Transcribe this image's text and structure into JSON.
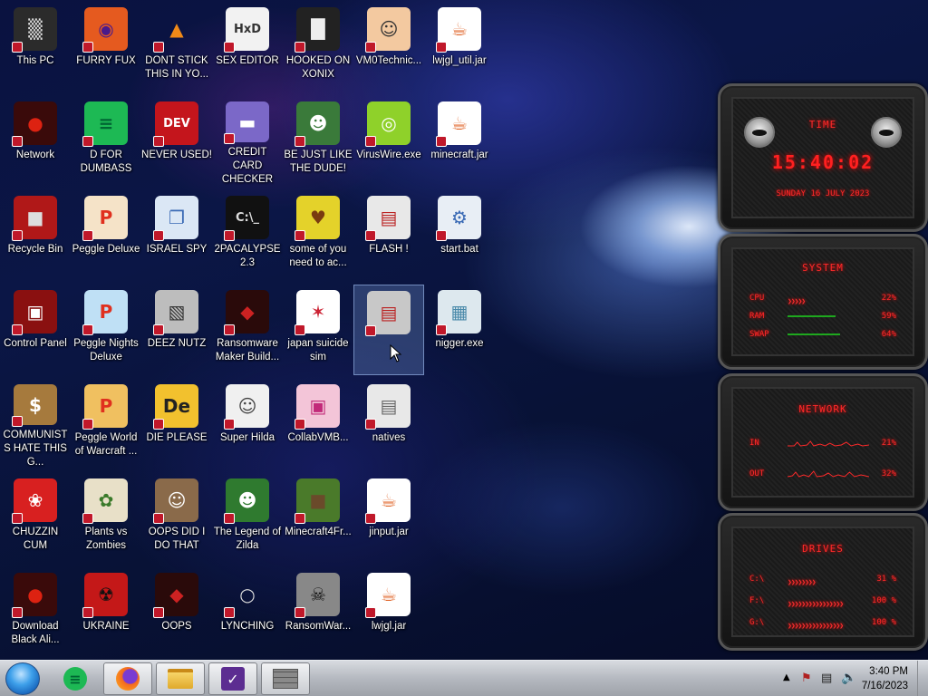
{
  "desktop": {
    "icons": [
      {
        "label": "This PC",
        "glyph": "▒",
        "bg": "#2b2b2b",
        "fg": "#ddd",
        "icon_name": "computer-icon"
      },
      {
        "label": "FURRY FUX",
        "glyph": "◉",
        "bg": "#e55a1f",
        "fg": "#4a1a8a",
        "icon_name": "firefox-icon"
      },
      {
        "label": "DONT STICK THIS IN YO...",
        "glyph": "▲",
        "bg": "transparent",
        "fg": "#f08a18",
        "icon_name": "vlc-cone-icon"
      },
      {
        "label": "SEX EDITOR",
        "glyph": "HxD",
        "bg": "#f2f2f2",
        "fg": "#333",
        "icon_name": "hex-editor-icon"
      },
      {
        "label": "HOOKED ON XONIX",
        "glyph": "█",
        "bg": "#222",
        "fg": "#eee",
        "icon_name": "xonix-icon"
      },
      {
        "label": "VM0Technic...",
        "glyph": "☺",
        "bg": "#f3c9a0",
        "fg": "#333",
        "icon_name": "doctor-icon"
      },
      {
        "label": "lwjgl_util.jar",
        "glyph": "☕",
        "bg": "#ffffff",
        "fg": "#e0662a",
        "icon_name": "java-jar-icon"
      },
      {
        "label": "Network",
        "glyph": "●",
        "bg": "#3a0a0a",
        "fg": "#d21",
        "icon_name": "network-icon"
      },
      {
        "label": "D FOR DUMBASS",
        "glyph": "≡",
        "bg": "#1db954",
        "fg": "#063",
        "icon_name": "green-d-icon"
      },
      {
        "label": "NEVER USED!",
        "glyph": "DEV",
        "bg": "#c4151c",
        "fg": "#fff",
        "icon_name": "devcpp-icon"
      },
      {
        "label": "CREDIT CARD CHECKER",
        "glyph": "▬",
        "bg": "#7b68c8",
        "fg": "#fff",
        "icon_name": "credit-card-icon"
      },
      {
        "label": "BE JUST LIKE THE DUDE!",
        "glyph": "☻",
        "bg": "#3a7a3a",
        "fg": "#fff",
        "icon_name": "elf-icon"
      },
      {
        "label": "VirusWire.exe",
        "glyph": "◎",
        "bg": "#8fd12a",
        "fg": "#fff",
        "icon_name": "lime-icon"
      },
      {
        "label": "minecraft.jar",
        "glyph": "☕",
        "bg": "#ffffff",
        "fg": "#e0662a",
        "icon_name": "java-jar-icon"
      },
      {
        "label": "Recycle Bin",
        "glyph": "■",
        "bg": "#b01818",
        "fg": "#ddd",
        "icon_name": "recycle-bin-icon"
      },
      {
        "label": "Peggle Deluxe",
        "glyph": "P",
        "bg": "#f5e3c8",
        "fg": "#e0301e",
        "icon_name": "peggle-icon"
      },
      {
        "label": "ISRAEL SPY",
        "glyph": "❐",
        "bg": "#dbe7f5",
        "fg": "#3a6ab5",
        "icon_name": "spy-network-icon"
      },
      {
        "label": "2PACALYPSE 2.3",
        "glyph": "C:\\_",
        "bg": "#111",
        "fg": "#ddd",
        "icon_name": "console-icon"
      },
      {
        "label": "some of you need to ac...",
        "glyph": "♥",
        "bg": "#e4d22a",
        "fg": "#7a3b10",
        "icon_name": "dog-icon"
      },
      {
        "label": "FLASH !",
        "glyph": "▤",
        "bg": "#e8e8e8",
        "fg": "#b22",
        "icon_name": "flash-file-icon"
      },
      {
        "label": "start.bat",
        "glyph": "⚙",
        "bg": "#e8eef5",
        "fg": "#3a6ab5",
        "icon_name": "batch-file-icon"
      },
      {
        "label": "Control Panel",
        "glyph": "▣",
        "bg": "#8a1010",
        "fg": "#fff",
        "icon_name": "control-panel-icon"
      },
      {
        "label": "Peggle Nights Deluxe",
        "glyph": "P",
        "bg": "#bfe0f5",
        "fg": "#e0301e",
        "icon_name": "peggle-nights-icon"
      },
      {
        "label": "DEEZ NUTZ",
        "glyph": "▧",
        "bg": "#bdbdbd",
        "fg": "#333",
        "icon_name": "stack-icon"
      },
      {
        "label": "Ransomware Maker Build...",
        "glyph": "◆",
        "bg": "#2a0a0a",
        "fg": "#c22",
        "icon_name": "ransomware-icon"
      },
      {
        "label": "japan suicide sim",
        "glyph": "✶",
        "bg": "#ffffff",
        "fg": "#c23",
        "icon_name": "game-file-icon"
      },
      {
        "label": "",
        "glyph": "▤",
        "bg": "#c8c8c8",
        "fg": "#b22",
        "icon_name": "selected-file-icon"
      },
      {
        "label": "nigger.exe",
        "glyph": "▦",
        "bg": "#dde8ee",
        "fg": "#4a8aaa",
        "icon_name": "exe-window-icon"
      },
      {
        "label": "COMMUNISTS HATE THIS G...",
        "glyph": "$",
        "bg": "#a67a3d",
        "fg": "#fff",
        "icon_name": "money-bag-icon"
      },
      {
        "label": "Peggle World of Warcraft ...",
        "glyph": "P",
        "bg": "#f0c060",
        "fg": "#e0301e",
        "icon_name": "peggle-wow-icon"
      },
      {
        "label": "DIE PLEASE",
        "glyph": "De",
        "bg": "#f2c12e",
        "fg": "#222",
        "icon_name": "de-icon"
      },
      {
        "label": "Super Hilda",
        "glyph": "☺",
        "bg": "#f0f0f0",
        "fg": "#444",
        "icon_name": "pixel-character-icon"
      },
      {
        "label": "CollabVMB...",
        "glyph": "▣",
        "bg": "#f3c5d8",
        "fg": "#c22a7a",
        "icon_name": "collabvm-icon"
      },
      {
        "label": "natives",
        "glyph": "▤",
        "bg": "#e8e8e8",
        "fg": "#666",
        "icon_name": "folder-file-icon"
      },
      {
        "label": "",
        "glyph": "",
        "bg": "transparent",
        "fg": "#fff",
        "icon_name": "empty-slot"
      },
      {
        "label": "CHUZZIN CUM",
        "glyph": "❀",
        "bg": "#d82020",
        "fg": "#fff",
        "icon_name": "chuzzle-icon"
      },
      {
        "label": "Plants vs Zombies",
        "glyph": "✿",
        "bg": "#e8e0c8",
        "fg": "#3a7a2a",
        "icon_name": "pvz-icon"
      },
      {
        "label": "OOPS DID I DO THAT",
        "glyph": "☺",
        "bg": "#8a6a4a",
        "fg": "#fff",
        "icon_name": "portrait-icon"
      },
      {
        "label": "The Legend of Zilda",
        "glyph": "☻",
        "bg": "#2f7a2f",
        "fg": "#fff",
        "icon_name": "zelda-icon"
      },
      {
        "label": "Minecraft4Fr...",
        "glyph": "■",
        "bg": "#4a7a2a",
        "fg": "#6a4a2a",
        "icon_name": "grass-block-icon"
      },
      {
        "label": "jinput.jar",
        "glyph": "☕",
        "bg": "#ffffff",
        "fg": "#e0662a",
        "icon_name": "java-jar-icon"
      },
      {
        "label": "",
        "glyph": "",
        "bg": "transparent",
        "fg": "#fff",
        "icon_name": "empty-slot"
      },
      {
        "label": "Download Black Ali...",
        "glyph": "●",
        "bg": "#3a0a0a",
        "fg": "#d21",
        "icon_name": "alien-download-icon"
      },
      {
        "label": "UKRAINE",
        "glyph": "☢",
        "bg": "#c41818",
        "fg": "#111",
        "icon_name": "radiation-icon"
      },
      {
        "label": "OOPS",
        "glyph": "◆",
        "bg": "#2a0a0a",
        "fg": "#c22",
        "icon_name": "ransomware-icon"
      },
      {
        "label": "LYNCHING",
        "glyph": "○",
        "bg": "transparent",
        "fg": "#ddd",
        "icon_name": "noose-icon"
      },
      {
        "label": "RansomWar...",
        "glyph": "☠",
        "bg": "#888",
        "fg": "#111",
        "icon_name": "skull-icon"
      },
      {
        "label": "lwjgl.jar",
        "glyph": "☕",
        "bg": "#ffffff",
        "fg": "#e0662a",
        "icon_name": "java-jar-icon"
      },
      {
        "label": "",
        "glyph": "",
        "bg": "transparent",
        "fg": "#fff",
        "icon_name": "empty-slot"
      }
    ]
  },
  "widgets": {
    "time": {
      "title": "TIME",
      "value": "15:40:02",
      "date": "SUNDAY 16 JULY 2023"
    },
    "system": {
      "title": "SYSTEM",
      "rows": [
        {
          "label": "CPU",
          "value": "22%",
          "level": 0.22,
          "style": "chevrons"
        },
        {
          "label": "RAM",
          "value": "59%",
          "level": 0.59,
          "style": "line"
        },
        {
          "label": "SWAP",
          "value": "64%",
          "level": 0.64,
          "style": "line"
        }
      ]
    },
    "network": {
      "title": "NETWORK",
      "rows": [
        {
          "label": "IN",
          "value": "21%"
        },
        {
          "label": "OUT",
          "value": "32%"
        }
      ]
    },
    "drives": {
      "title": "DRIVES",
      "rows": [
        {
          "label": "C:\\",
          "value": "31 %"
        },
        {
          "label": "F:\\",
          "value": "100 %"
        },
        {
          "label": "G:\\",
          "value": "100 %"
        }
      ]
    },
    "accent": "#ff2020"
  },
  "taskbar": {
    "buttons": [
      {
        "name": "start-button",
        "icon": "start-orb-icon"
      },
      {
        "name": "pinned-green-app",
        "icon": "green-d-icon"
      },
      {
        "name": "firefox-button",
        "icon": "firefox-icon"
      },
      {
        "name": "explorer-button",
        "icon": "folder-icon"
      },
      {
        "name": "visual-studio-button",
        "icon": "vs-installer-icon"
      },
      {
        "name": "wall-app-button",
        "icon": "brick-wall-icon"
      }
    ],
    "clock": {
      "time": "3:40 PM",
      "date": "7/16/2023"
    }
  }
}
